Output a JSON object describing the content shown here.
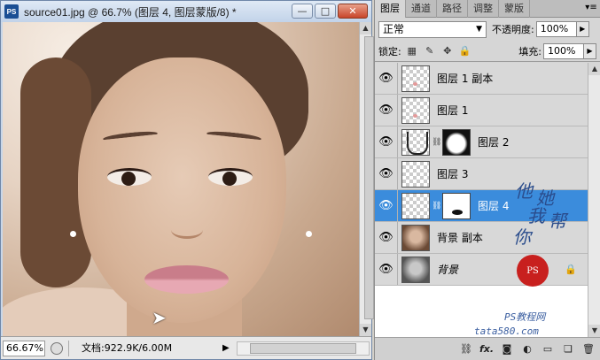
{
  "document": {
    "app_icon": "PS",
    "title": "source01.jpg @ 66.7% (图层 4, 图层蒙版/8) *",
    "win_minimize": "—",
    "win_maximize": "□",
    "win_close": "✕",
    "zoom": "66.67%",
    "doc_info": "文档:922.9K/6.00M"
  },
  "panel": {
    "tabs": [
      "图层",
      "通道",
      "路径",
      "调整",
      "蒙版"
    ],
    "active_tab": "图层",
    "blend_mode": "正常",
    "opacity_label": "不透明度:",
    "opacity_value": "100%",
    "lock_label": "锁定:",
    "fill_label": "填充:",
    "fill_value": "100%",
    "layers": [
      {
        "name": "图层 1 副本",
        "visible": true,
        "thumb": "transparent-dot",
        "mask": null,
        "selected": false,
        "locked": false
      },
      {
        "name": "图层 1",
        "visible": true,
        "thumb": "transparent-dot",
        "mask": null,
        "selected": false,
        "locked": false
      },
      {
        "name": "图层 2",
        "visible": true,
        "thumb": "face-outline",
        "mask": "frame",
        "selected": false,
        "locked": false
      },
      {
        "name": "图层 3",
        "visible": true,
        "thumb": "transparent",
        "mask": null,
        "selected": false,
        "locked": false
      },
      {
        "name": "图层 4",
        "visible": true,
        "thumb": "transparent",
        "mask": "mouth",
        "selected": true,
        "locked": false
      },
      {
        "name": "背景 副本",
        "visible": true,
        "thumb": "photo",
        "mask": null,
        "selected": false,
        "locked": false
      },
      {
        "name": "背景",
        "visible": true,
        "thumb": "photo-bw",
        "mask": null,
        "selected": false,
        "locked": true
      }
    ]
  },
  "watermark": {
    "chars": [
      "他",
      "她",
      "我",
      "帮",
      "你"
    ],
    "seal": "PS",
    "url1": "PS教程网",
    "url2": "tata580.com"
  },
  "colors": {
    "selected_layer": "#3b8cdc",
    "panel_bg": "#d6d6d6",
    "seal_red": "#c8201e"
  }
}
